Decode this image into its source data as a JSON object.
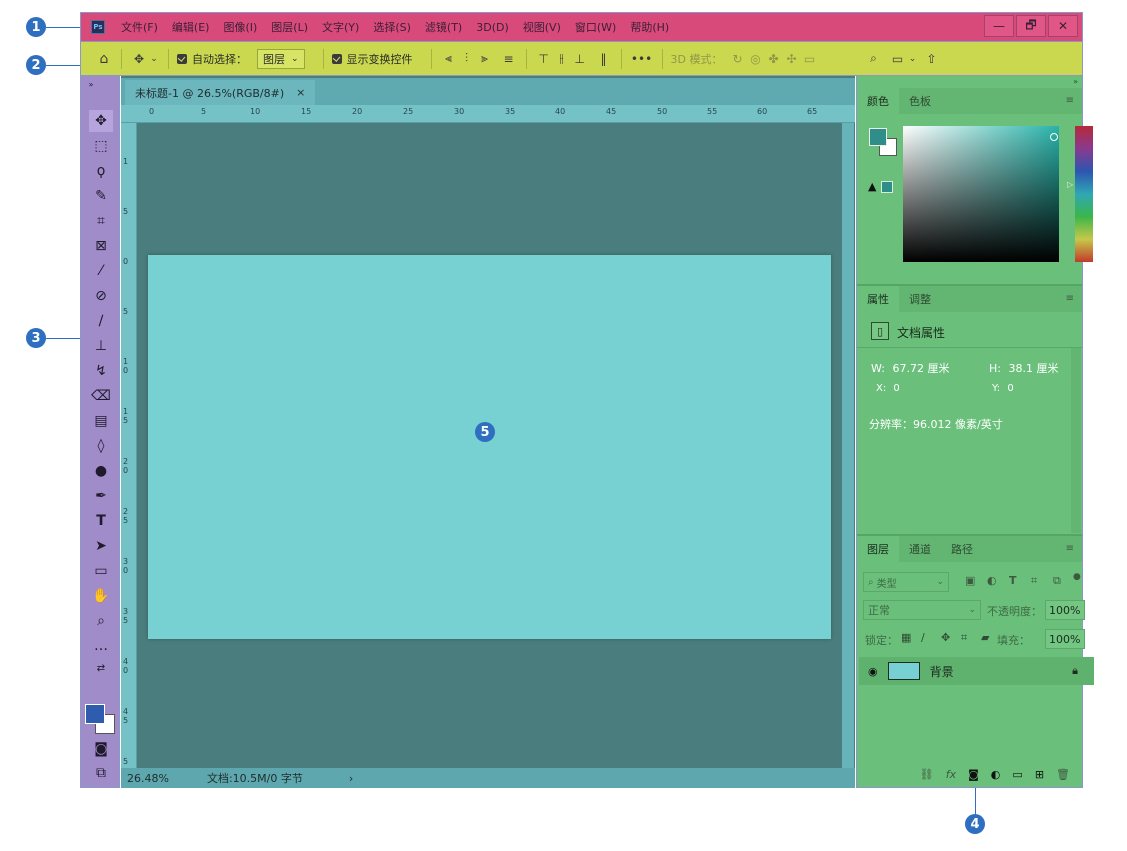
{
  "callouts": [
    "1",
    "2",
    "3",
    "4",
    "5"
  ],
  "menubar": {
    "logo": "Ps",
    "items": [
      "文件(F)",
      "编辑(E)",
      "图像(I)",
      "图层(L)",
      "文字(Y)",
      "选择(S)",
      "滤镜(T)",
      "3D(D)",
      "视图(V)",
      "窗口(W)",
      "帮助(H)"
    ],
    "window_controls": [
      "—",
      "🗗",
      "✕"
    ]
  },
  "optbar": {
    "auto_select_label": "自动选择：",
    "auto_select_value": "图层",
    "show_transform_label": "显示变换控件",
    "more": "•••",
    "mode_3d_label": "3D 模式："
  },
  "document": {
    "tab_title": "未标题-1 @ 26.5%(RGB/8#)",
    "tab_close": "×",
    "ruler_h": [
      "0",
      "5",
      "10",
      "15",
      "20",
      "25",
      "30",
      "35",
      "40",
      "45",
      "50",
      "55",
      "60",
      "65"
    ],
    "ruler_v": [
      "1",
      "5",
      "0",
      "5",
      "1 0",
      "1 5",
      "2 0",
      "2 5",
      "3 0",
      "3 5",
      "4 0",
      "4 5",
      "5"
    ],
    "zoom": "26.48%",
    "doc_info": "文档:10.5M/0 字节",
    "status_arrow": "›"
  },
  "color_panel": {
    "tabs": [
      "颜色",
      "色板"
    ],
    "fg_color": "#2f8e8a",
    "bg_color": "#ffffff"
  },
  "properties_panel": {
    "tabs": [
      "属性",
      "调整"
    ],
    "section_title": "文档属性",
    "w_label": "W:",
    "w_value": "67.72 厘米",
    "h_label": "H:",
    "h_value": "38.1 厘米",
    "x_label": "X:",
    "x_value": "0",
    "y_label": "Y:",
    "y_value": "0",
    "resolution": "分辨率：96.012 像素/英寸"
  },
  "layers_panel": {
    "tabs": [
      "图层",
      "通道",
      "路径"
    ],
    "filter_label": "类型",
    "blend_mode": "正常",
    "opacity_label": "不透明度：",
    "opacity_value": "100%",
    "lock_label": "锁定：",
    "fill_label": "填充：",
    "fill_value": "100%",
    "layers": [
      {
        "name": "背景",
        "visible": true,
        "locked": true
      }
    ],
    "fx_label": "fx"
  },
  "colors": {
    "menubar": "#d84a7a",
    "optbar": "#c9d84e",
    "tools": "#9f8cc9",
    "right_panels": "#6ac07a",
    "canvas": "#77d0d1",
    "workspace": "#4a7d7d",
    "callout": "#2e6fbf"
  }
}
